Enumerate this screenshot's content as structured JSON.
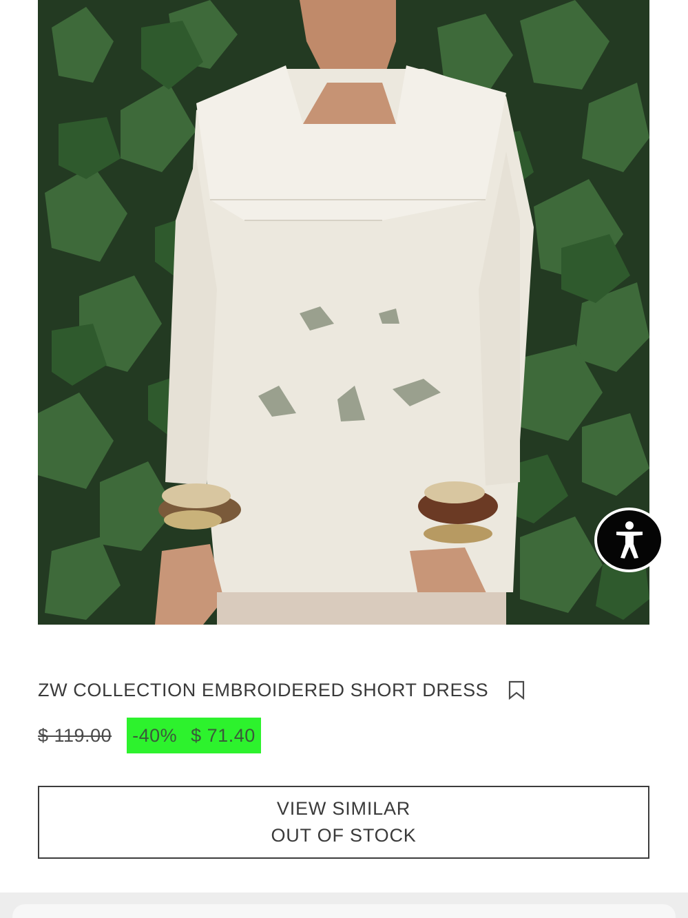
{
  "product": {
    "image_alt": "Model wearing a white embroidered short dress with sailor collar in front of ivy leaves",
    "title": "ZW COLLECTION EMBROIDERED SHORT DRESS",
    "old_price": "$ 119.00",
    "discount": "-40%",
    "sale_price": "$ 71.40"
  },
  "actions": {
    "view_similar_label": "VIEW SIMILAR",
    "stock_status": "OUT OF STOCK"
  },
  "icons": {
    "bookmark": "bookmark-icon",
    "accessibility": "accessibility-icon"
  },
  "colors": {
    "sale_badge_bg": "#2df22d",
    "accessibility_button_bg": "#050505",
    "button_border": "#3c3c3c"
  }
}
